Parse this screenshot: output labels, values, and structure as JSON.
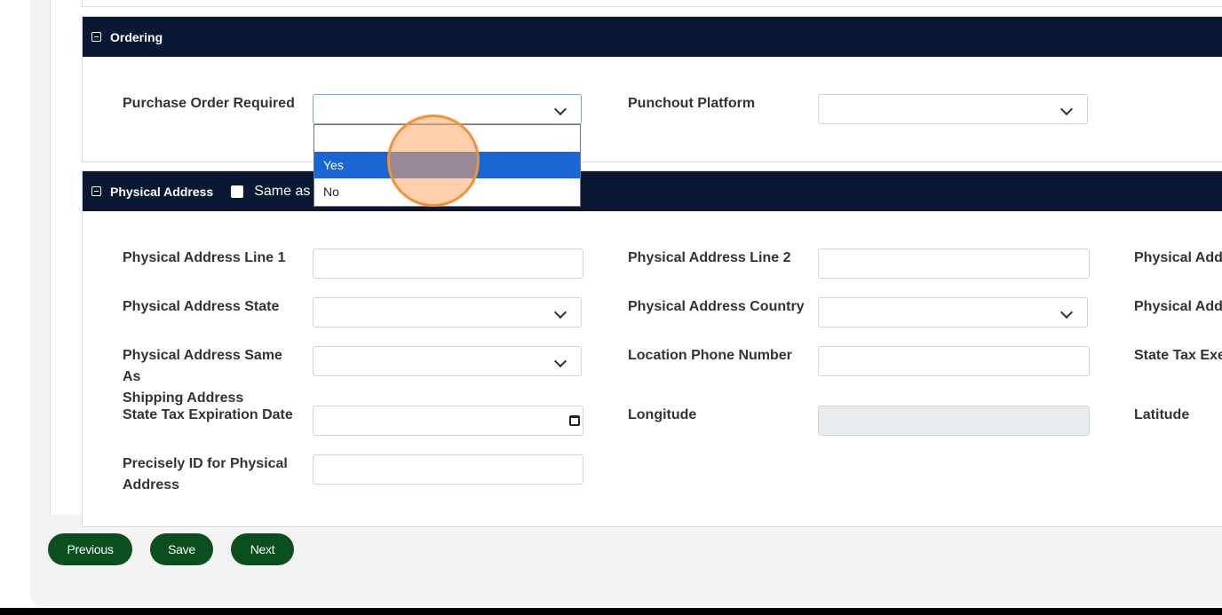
{
  "ordering": {
    "title": "Ordering",
    "purchase_order_required_label": "Purchase Order Required",
    "purchase_order_required_value": "",
    "purchase_order_options": [
      "",
      "Yes",
      "No"
    ],
    "punchout_platform_label": "Punchout Platform",
    "punchout_platform_value": ""
  },
  "physical_address": {
    "title": "Physical Address",
    "same_as_label": "Same as",
    "fields": {
      "line1_label": "Physical Address Line 1",
      "line2_label": "Physical Address Line 2",
      "col3_row1_label": "Physical Addr",
      "state_label": "Physical Address State",
      "country_label": "Physical Address Country",
      "col3_row2_label": "Physical Addr",
      "same_as_shipping_label_1": "Physical Address Same As",
      "same_as_shipping_label_2": "Shipping Address",
      "location_phone_label": "Location Phone Number",
      "state_tax_exempt_label": "State Tax Exen",
      "state_tax_exp_label": "State Tax Expiration Date",
      "longitude_label": "Longitude",
      "latitude_label": "Latitude",
      "precisely_id_label_1": "Precisely ID for Physical",
      "precisely_id_label_2": "Address"
    }
  },
  "buttons": {
    "previous": "Previous",
    "save": "Save",
    "next": "Next"
  },
  "colors": {
    "header_bg": "#0b1833",
    "button_bg": "#0b4f1e",
    "selected_option": "#1a66d2"
  }
}
